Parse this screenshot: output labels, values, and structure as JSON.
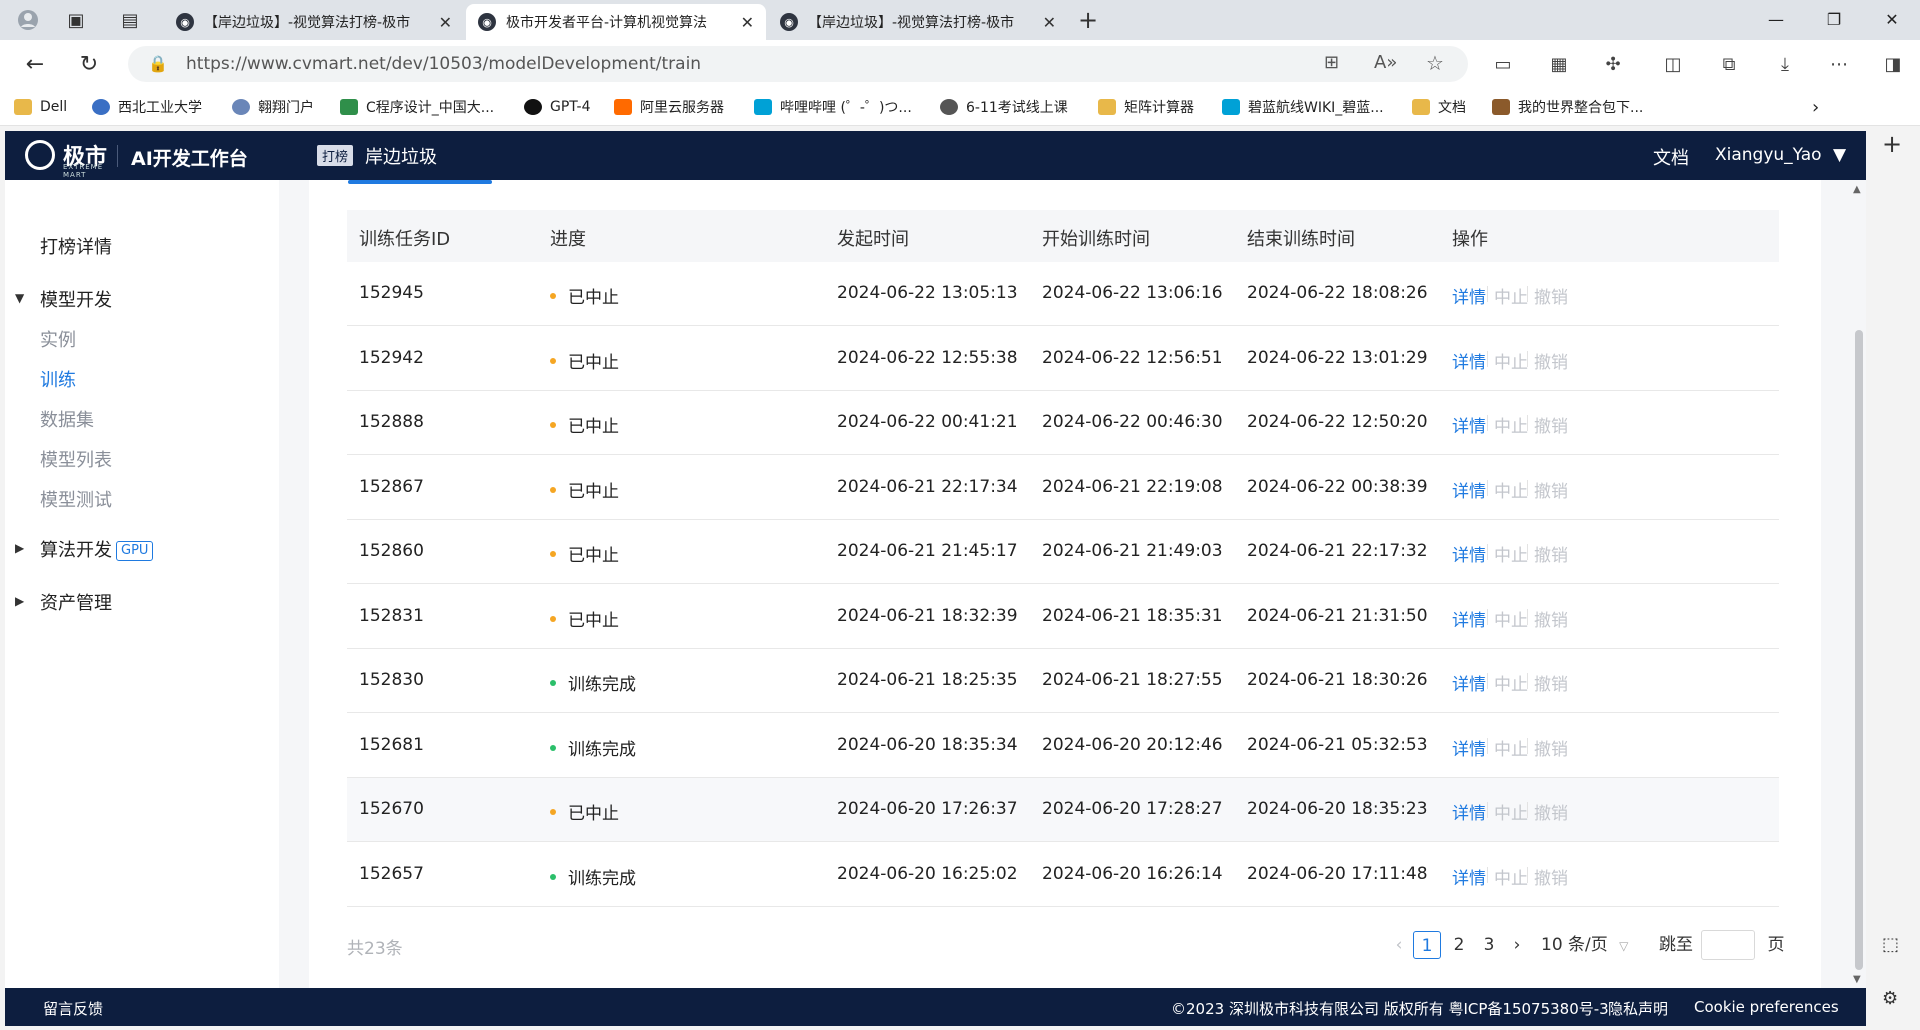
{
  "browser": {
    "tabs": [
      {
        "title": "【岸边垃圾】-视觉算法打榜-极市",
        "active": false
      },
      {
        "title": "极市开发者平台-计算机视觉算法",
        "active": true
      },
      {
        "title": "【岸边垃圾】-视觉算法打榜-极市",
        "active": false
      }
    ],
    "url": "https://www.cvmart.net/dev/10503/modelDevelopment/train",
    "bookmarks": [
      "Dell",
      "西北工业大学",
      "翱翔门户",
      "C程序设计_中国大...",
      "GPT-4",
      "阿里云服务器",
      "哔哩哔哩 (゜-゜)つ...",
      "6-11考试线上课",
      "矩阵计算器",
      "碧蓝航线WIKI_碧蓝...",
      "文档",
      "我的世界整合包下..."
    ]
  },
  "header": {
    "logo_text": "极市",
    "logo_sub": "EXTREME MART",
    "app_title": "AI开发工作台",
    "competition_tag": "打榜",
    "competition_name": "岸边垃圾",
    "docs_link": "文档",
    "user_name": "Xiangyu_Yao"
  },
  "sidebar": {
    "leaderboard": "打榜详情",
    "model_dev": "模型开发",
    "items": [
      "实例",
      "训练",
      "数据集",
      "模型列表",
      "模型测试"
    ],
    "algo_dev": "算法开发",
    "gpu_badge": "GPU",
    "asset_mgmt": "资产管理"
  },
  "table": {
    "headers": [
      "训练任务ID",
      "进度",
      "发起时间",
      "开始训练时间",
      "结束训练时间",
      "操作"
    ],
    "actions": [
      "详情",
      "中止",
      "撤销"
    ],
    "rows": [
      {
        "id": "152945",
        "status": "已中止",
        "start": "2024-06-22 13:05:13",
        "train_start": "2024-06-22 13:06:16",
        "train_end": "2024-06-22 18:08:26"
      },
      {
        "id": "152942",
        "status": "已中止",
        "start": "2024-06-22 12:55:38",
        "train_start": "2024-06-22 12:56:51",
        "train_end": "2024-06-22 13:01:29"
      },
      {
        "id": "152888",
        "status": "已中止",
        "start": "2024-06-22 00:41:21",
        "train_start": "2024-06-22 00:46:30",
        "train_end": "2024-06-22 12:50:20"
      },
      {
        "id": "152867",
        "status": "已中止",
        "start": "2024-06-21 22:17:34",
        "train_start": "2024-06-21 22:19:08",
        "train_end": "2024-06-22 00:38:39"
      },
      {
        "id": "152860",
        "status": "已中止",
        "start": "2024-06-21 21:45:17",
        "train_start": "2024-06-21 21:49:03",
        "train_end": "2024-06-21 22:17:32"
      },
      {
        "id": "152831",
        "status": "已中止",
        "start": "2024-06-21 18:32:39",
        "train_start": "2024-06-21 18:35:31",
        "train_end": "2024-06-21 21:31:50"
      },
      {
        "id": "152830",
        "status": "训练完成",
        "start": "2024-06-21 18:25:35",
        "train_start": "2024-06-21 18:27:55",
        "train_end": "2024-06-21 18:30:26"
      },
      {
        "id": "152681",
        "status": "训练完成",
        "start": "2024-06-20 18:35:34",
        "train_start": "2024-06-20 20:12:46",
        "train_end": "2024-06-21 05:32:53"
      },
      {
        "id": "152670",
        "status": "已中止",
        "start": "2024-06-20 17:26:37",
        "train_start": "2024-06-20 17:28:27",
        "train_end": "2024-06-20 18:35:23"
      },
      {
        "id": "152657",
        "status": "训练完成",
        "start": "2024-06-20 16:25:02",
        "train_start": "2024-06-20 16:26:14",
        "train_end": "2024-06-20 17:11:48"
      }
    ]
  },
  "pagination": {
    "total": "共23条",
    "pages": [
      "1",
      "2",
      "3"
    ],
    "current": "1",
    "page_size": "10 条/页",
    "jump_label": "跳至",
    "page_unit": "页"
  },
  "footer": {
    "feedback": "留言反馈",
    "copyright": "©2023 深圳极市科技有限公司 版权所有 粤ICP备15075380号-3",
    "privacy": "隐私声明",
    "cookie": "Cookie preferences"
  },
  "colors": {
    "header_bg": "#0d1e3f",
    "accent": "#1f7ae0",
    "status_stopped": "#f5a623",
    "status_done": "#2bbf6a"
  }
}
